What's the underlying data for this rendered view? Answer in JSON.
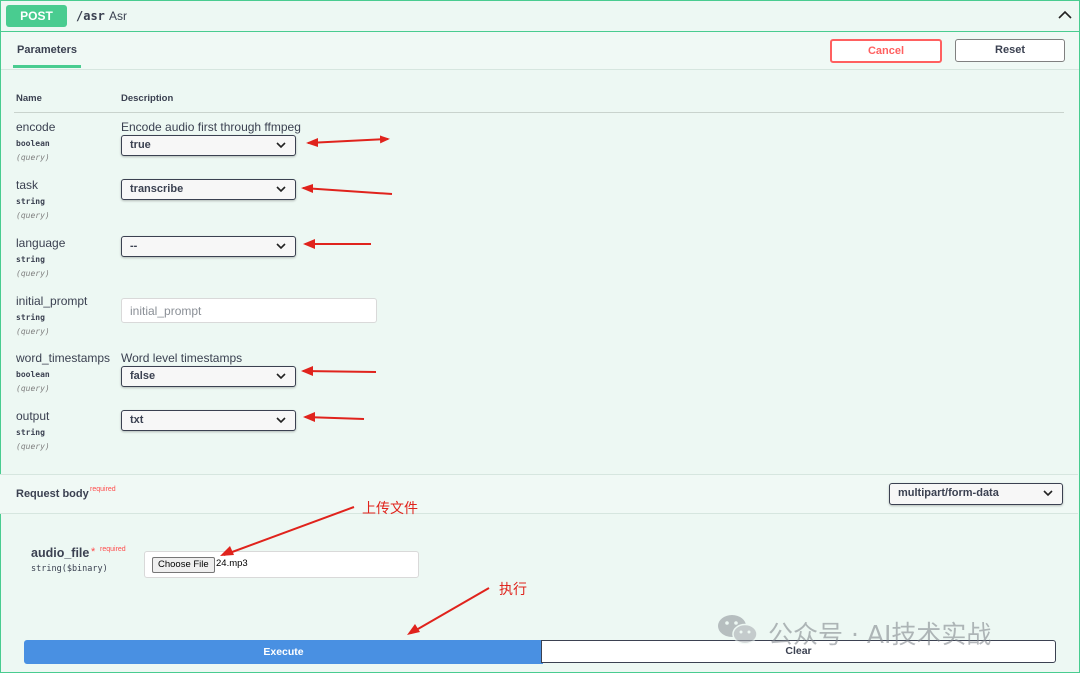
{
  "endpoint": {
    "method": "POST",
    "path": "/asr",
    "description": "Asr"
  },
  "params_header": {
    "tab": "Parameters",
    "cancel_label": "Cancel",
    "reset_label": "Reset"
  },
  "columns": {
    "name": "Name",
    "description": "Description"
  },
  "parameters": [
    {
      "name": "encode",
      "type": "boolean",
      "in": "(query)",
      "description": "Encode audio first through ffmpeg",
      "value": "true"
    },
    {
      "name": "task",
      "type": "string",
      "in": "(query)",
      "description": "",
      "value": "transcribe"
    },
    {
      "name": "language",
      "type": "string",
      "in": "(query)",
      "description": "",
      "value": "--"
    },
    {
      "name": "initial_prompt",
      "type": "string",
      "in": "(query)",
      "description": "",
      "placeholder": "initial_prompt"
    },
    {
      "name": "word_timestamps",
      "type": "boolean",
      "in": "(query)",
      "description": "Word level timestamps",
      "value": "false"
    },
    {
      "name": "output",
      "type": "string",
      "in": "(query)",
      "description": "",
      "value": "txt"
    }
  ],
  "request_body": {
    "title": "Request body",
    "required_label": "required",
    "content_type": "multipart/form-data",
    "field_name": "audio_file",
    "field_star": "*",
    "field_required": "required",
    "field_type": "string($binary)",
    "choose_file_label": "Choose File",
    "chosen_file": "24.mp3"
  },
  "actions": {
    "execute_label": "Execute",
    "clear_label": "Clear"
  },
  "annotations": {
    "upload": "上传文件",
    "execute": "执行",
    "color": "#e0231c"
  },
  "watermark": {
    "text": "公众号 · AI技术实战"
  },
  "colors": {
    "post_green": "#49cc90",
    "execute_blue": "#4990e2",
    "cancel_red": "#ff6060"
  }
}
